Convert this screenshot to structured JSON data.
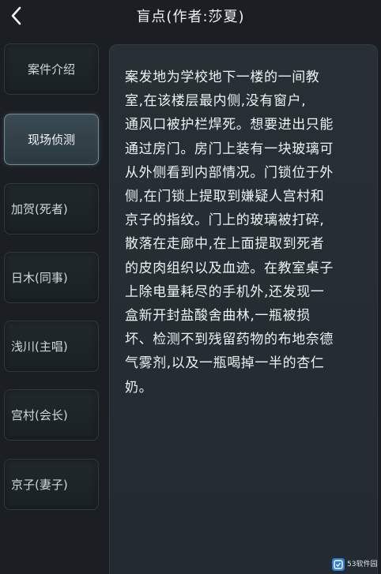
{
  "header": {
    "title": "盲点(作者:莎夏)",
    "back_icon": "chevron-left-icon"
  },
  "sidebar": {
    "items": [
      {
        "label": "案件介绍",
        "active": false
      },
      {
        "label": "现场侦测",
        "active": true
      },
      {
        "label": "加贺(死者)",
        "active": false
      },
      {
        "label": "日木(同事)",
        "active": false
      },
      {
        "label": "浅川(主唱)",
        "active": false
      },
      {
        "label": "宫村(会长)",
        "active": false
      },
      {
        "label": "京子(妻子)",
        "active": false
      }
    ]
  },
  "content": {
    "text": "案发地为学校地下一楼的一间教\n室,在该楼层最内侧,没有窗户,\n通风口被护栏焊死。想要进出只能\n通过房门。房门上装有一块玻璃可\n从外侧看到内部情况。门锁位于外\n侧,在门锁上提取到嫌疑人宫村和\n京子的指纹。门上的玻璃被打碎,\n散落在走廊中,在上面提取到死者\n的皮肉组织以及血迹。在教室桌子\n上除电量耗尽的手机外,还发现一\n盒新开封盐酸舍曲林,一瓶被损\n坏、检测不到残留药物的布地奈德\n气雾剂,以及一瓶喝掉一半的杏仁\n奶。"
  },
  "watermark": {
    "text": "53软件园",
    "accent": "#2f7de1"
  },
  "colors": {
    "background": "#1b1f23",
    "panel": "#263035",
    "active_item": "#3a4a52",
    "text": "#eef2f3"
  }
}
